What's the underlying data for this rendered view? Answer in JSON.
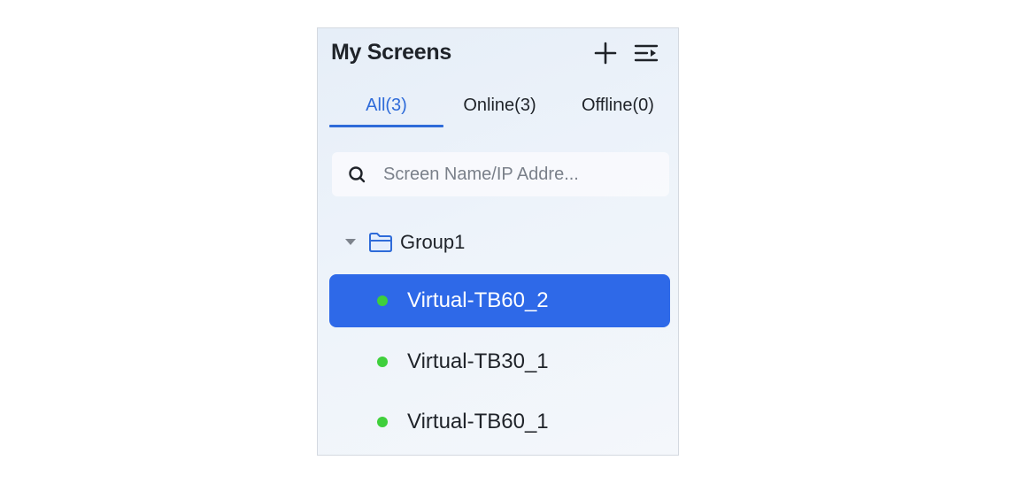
{
  "panel": {
    "title": "My Screens",
    "add_icon": "plus-icon",
    "filter_icon": "filter-list-icon"
  },
  "tabs": [
    {
      "label": "All(3)",
      "active": true
    },
    {
      "label": "Online(3)",
      "active": false
    },
    {
      "label": "Offline(0)",
      "active": false
    }
  ],
  "search": {
    "placeholder": "Screen Name/IP Addre...",
    "value": "",
    "icon": "search-icon"
  },
  "tree": {
    "group": {
      "label": "Group1",
      "expanded": true,
      "icon": "folder-icon"
    },
    "screens": [
      {
        "name": "Virtual-TB60_2",
        "status": "online",
        "selected": true
      },
      {
        "name": "Virtual-TB30_1",
        "status": "online",
        "selected": false
      },
      {
        "name": "Virtual-TB60_1",
        "status": "online",
        "selected": false
      }
    ]
  },
  "colors": {
    "accent": "#2e6bd9",
    "selected_row": "#2e69e8",
    "online_dot": "#3fcf3c",
    "text": "#1f2329"
  }
}
